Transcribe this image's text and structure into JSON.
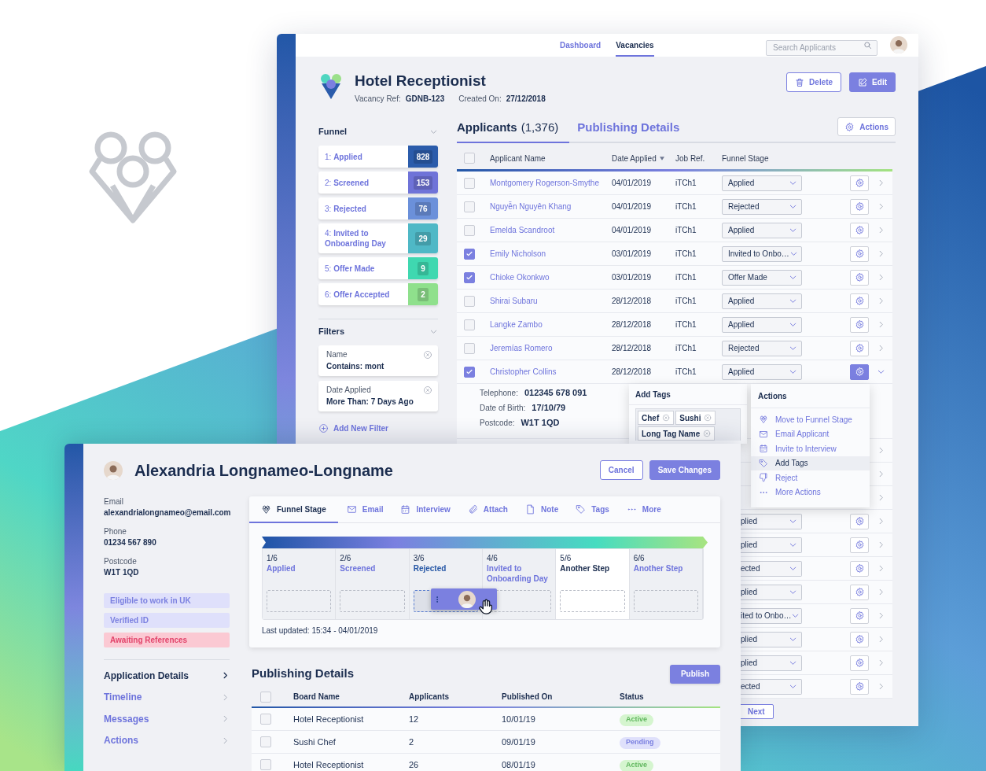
{
  "vacancy_window": {
    "nav": [
      {
        "label": "Dashboard",
        "selected": false
      },
      {
        "label": "Vacancies",
        "selected": true
      }
    ],
    "search": {
      "placeholder": "Search Applicants"
    },
    "title": "Hotel Receptionist",
    "meta": [
      {
        "label": "Vacancy Ref:",
        "value": "GDNB-123"
      },
      {
        "label": "Created On:",
        "value": "27/12/2018"
      }
    ],
    "header_buttons": [
      {
        "label": "Delete",
        "kind": "outline"
      },
      {
        "label": "Edit",
        "kind": "primary"
      }
    ],
    "funnel": {
      "title": "Funnel",
      "stages": [
        {
          "label": "1: **Applied**",
          "count": "828",
          "color": "#2b5cab"
        },
        {
          "label": "2: **Screened**",
          "count": "153",
          "color": "#6f73d8"
        },
        {
          "label": "3: **Rejected**",
          "count": "76",
          "color": "#6b90da"
        },
        {
          "label": "4: **Invited to Onboarding Day**",
          "count": "29",
          "color": "#4fb8c6"
        },
        {
          "label": "5: **Offer Made**",
          "count": "9",
          "color": "#3fd8b0"
        },
        {
          "label": "6: **Offer Accepted**",
          "count": "2",
          "color": "#8fe08c"
        }
      ]
    },
    "filters": {
      "title": "Filters",
      "items": [
        {
          "name": "Name",
          "value": "Contains: mont"
        },
        {
          "name": "Date Applied",
          "value": "More Than: 7 Days Ago"
        }
      ],
      "add_label": "Add New Filter"
    },
    "tabs": [
      {
        "label": "Applicants",
        "count": "(1,376)",
        "selected": true
      },
      {
        "label": "Publishing Details",
        "selected": false
      }
    ],
    "actions_button": "Actions",
    "table": {
      "select_all": {
        "checked": false
      },
      "columns": [
        "Applicant Name",
        "Date Applied",
        "Job Ref.",
        "Funnel Stage"
      ],
      "rows": [
        {
          "name": "Montgomery Rogerson-Smythe",
          "date": "04/01/2019",
          "job_ref": "iTCh1",
          "stage": "Applied",
          "checked": false,
          "expanded": false
        },
        {
          "name": "Nguyễn Nguyên Khang",
          "date": "04/01/2019",
          "job_ref": "iTCh1",
          "stage": "Rejected",
          "checked": false,
          "expanded": false
        },
        {
          "name": "Emelda Scandroot",
          "date": "04/01/2019",
          "job_ref": "iTCh1",
          "stage": "Applied",
          "checked": false,
          "expanded": false
        },
        {
          "name": "Emily Nicholson",
          "date": "03/01/2019",
          "job_ref": "iTCh1",
          "stage": "Invited to Onbo…",
          "checked": true,
          "expanded": false
        },
        {
          "name": "Chioke Okonkwo",
          "date": "03/01/2019",
          "job_ref": "iTCh1",
          "stage": "Offer Made",
          "checked": true,
          "expanded": false
        },
        {
          "name": "Shirai Subaru",
          "date": "28/12/2018",
          "job_ref": "iTCh1",
          "stage": "Applied",
          "checked": false,
          "expanded": false
        },
        {
          "name": "Langke Zambo",
          "date": "28/12/2018",
          "job_ref": "iTCh1",
          "stage": "Applied",
          "checked": false,
          "expanded": false
        },
        {
          "name": "Jeremías Romero",
          "date": "28/12/2018",
          "job_ref": "iTCh1",
          "stage": "Rejected",
          "checked": false,
          "expanded": false
        },
        {
          "name": "Christopher Collins",
          "date": "28/12/2018",
          "job_ref": "iTCh1",
          "stage": "Applied",
          "checked": true,
          "expanded": true
        }
      ],
      "details": [
        {
          "label": "Telephone:",
          "value": "012345 678 091"
        },
        {
          "label": "Date of Birth:",
          "value": "17/10/79"
        },
        {
          "label": "Postcode:",
          "value": "W1T 1QD"
        }
      ],
      "more_rows": [
        {
          "kind": "covered"
        },
        {
          "kind": "covered"
        },
        {
          "kind": "covered"
        },
        {
          "kind": "partial",
          "stage": "plied"
        },
        {
          "kind": "partial",
          "stage": "plied"
        },
        {
          "kind": "partial",
          "stage": "ected"
        },
        {
          "kind": "partial",
          "stage": "plied"
        },
        {
          "kind": "partial",
          "stage": "ited to Onbo…"
        },
        {
          "kind": "partial",
          "stage": "plied"
        },
        {
          "kind": "partial",
          "stage": "plied"
        },
        {
          "kind": "partial",
          "stage": "ected"
        }
      ]
    },
    "next_button": "Next"
  },
  "add_tags_popup": {
    "title": "Add Tags",
    "tags": [
      "Chef",
      "Sushi",
      "Long Tag Name"
    ]
  },
  "actions_menu": {
    "title": "Actions",
    "items": [
      {
        "label": "Move to Funnel Stage",
        "kind": "funnel",
        "selected": false
      },
      {
        "label": "Email Applicant",
        "kind": "mail",
        "selected": false
      },
      {
        "label": "Invite to Interview",
        "kind": "calendar",
        "selected": false
      },
      {
        "label": "Add Tags",
        "kind": "tag",
        "selected": true
      },
      {
        "label": "Reject",
        "kind": "reject",
        "selected": false
      },
      {
        "label": "More Actions",
        "kind": "more",
        "selected": false
      }
    ]
  },
  "applicant_window": {
    "name": "Alexandria Longnameo-Longname",
    "buttons": [
      {
        "label": "Cancel",
        "kind": "outline"
      },
      {
        "label": "Save Changes",
        "kind": "primary"
      }
    ],
    "contact": [
      {
        "label": "Email",
        "value": "alexandrialongnameo@email.com"
      },
      {
        "label": "Phone",
        "value": "01234 567 890"
      },
      {
        "label": "Postcode",
        "value": "W1T 1QD"
      }
    ],
    "badges": [
      {
        "label": "Eligible to work in UK",
        "kind": "info"
      },
      {
        "label": "Verified ID",
        "kind": "info"
      },
      {
        "label": "Awaiting References",
        "kind": "warning"
      }
    ],
    "nav": [
      {
        "label": "Application Details",
        "selected": true
      },
      {
        "label": "Timeline",
        "selected": false
      },
      {
        "label": "Messages",
        "selected": false
      },
      {
        "label": "Actions",
        "selected": false
      }
    ],
    "tabs": [
      {
        "label": "Funnel Stage",
        "kind": "funnel",
        "selected": true
      },
      {
        "label": "Email",
        "kind": "mail",
        "selected": false
      },
      {
        "label": "Interview",
        "kind": "calendar",
        "selected": false
      },
      {
        "label": "Attach",
        "kind": "attach",
        "selected": false
      },
      {
        "label": "Note",
        "kind": "note",
        "selected": false
      },
      {
        "label": "Tags",
        "kind": "tag",
        "selected": false
      },
      {
        "label": "More",
        "kind": "more",
        "selected": false
      }
    ],
    "stages": [
      {
        "step": "1/6",
        "label": "Applied",
        "kind": "normal"
      },
      {
        "step": "2/6",
        "label": "Screened",
        "kind": "normal"
      },
      {
        "step": "3/6",
        "label": "Rejected",
        "kind": "target"
      },
      {
        "step": "4/6",
        "label": "Invited to Onboarding Day",
        "kind": "normal"
      },
      {
        "step": "5/6",
        "label": "Another Step",
        "kind": "hover"
      },
      {
        "step": "6/6",
        "label": "Another Step",
        "kind": "normal"
      }
    ],
    "last_updated": "Last updated: 15:34 - 04/01/2019",
    "publishing": {
      "title": "Publishing Details",
      "button": "Publish",
      "select_all": {
        "checked": false
      },
      "columns": [
        "Board Name",
        "Applicants",
        "Published On",
        "Status"
      ],
      "rows": [
        {
          "board": "Hotel Receptionist",
          "applicants": "12",
          "published": "10/01/19",
          "status": "Active",
          "kind": "active",
          "checked": false
        },
        {
          "board": "Sushi Chef",
          "applicants": "2",
          "published": "09/01/19",
          "status": "Pending",
          "kind": "pending",
          "checked": false
        },
        {
          "board": "Hotel Receptionist",
          "applicants": "26",
          "published": "08/01/19",
          "status": "Active",
          "kind": "active",
          "checked": false
        }
      ]
    }
  }
}
